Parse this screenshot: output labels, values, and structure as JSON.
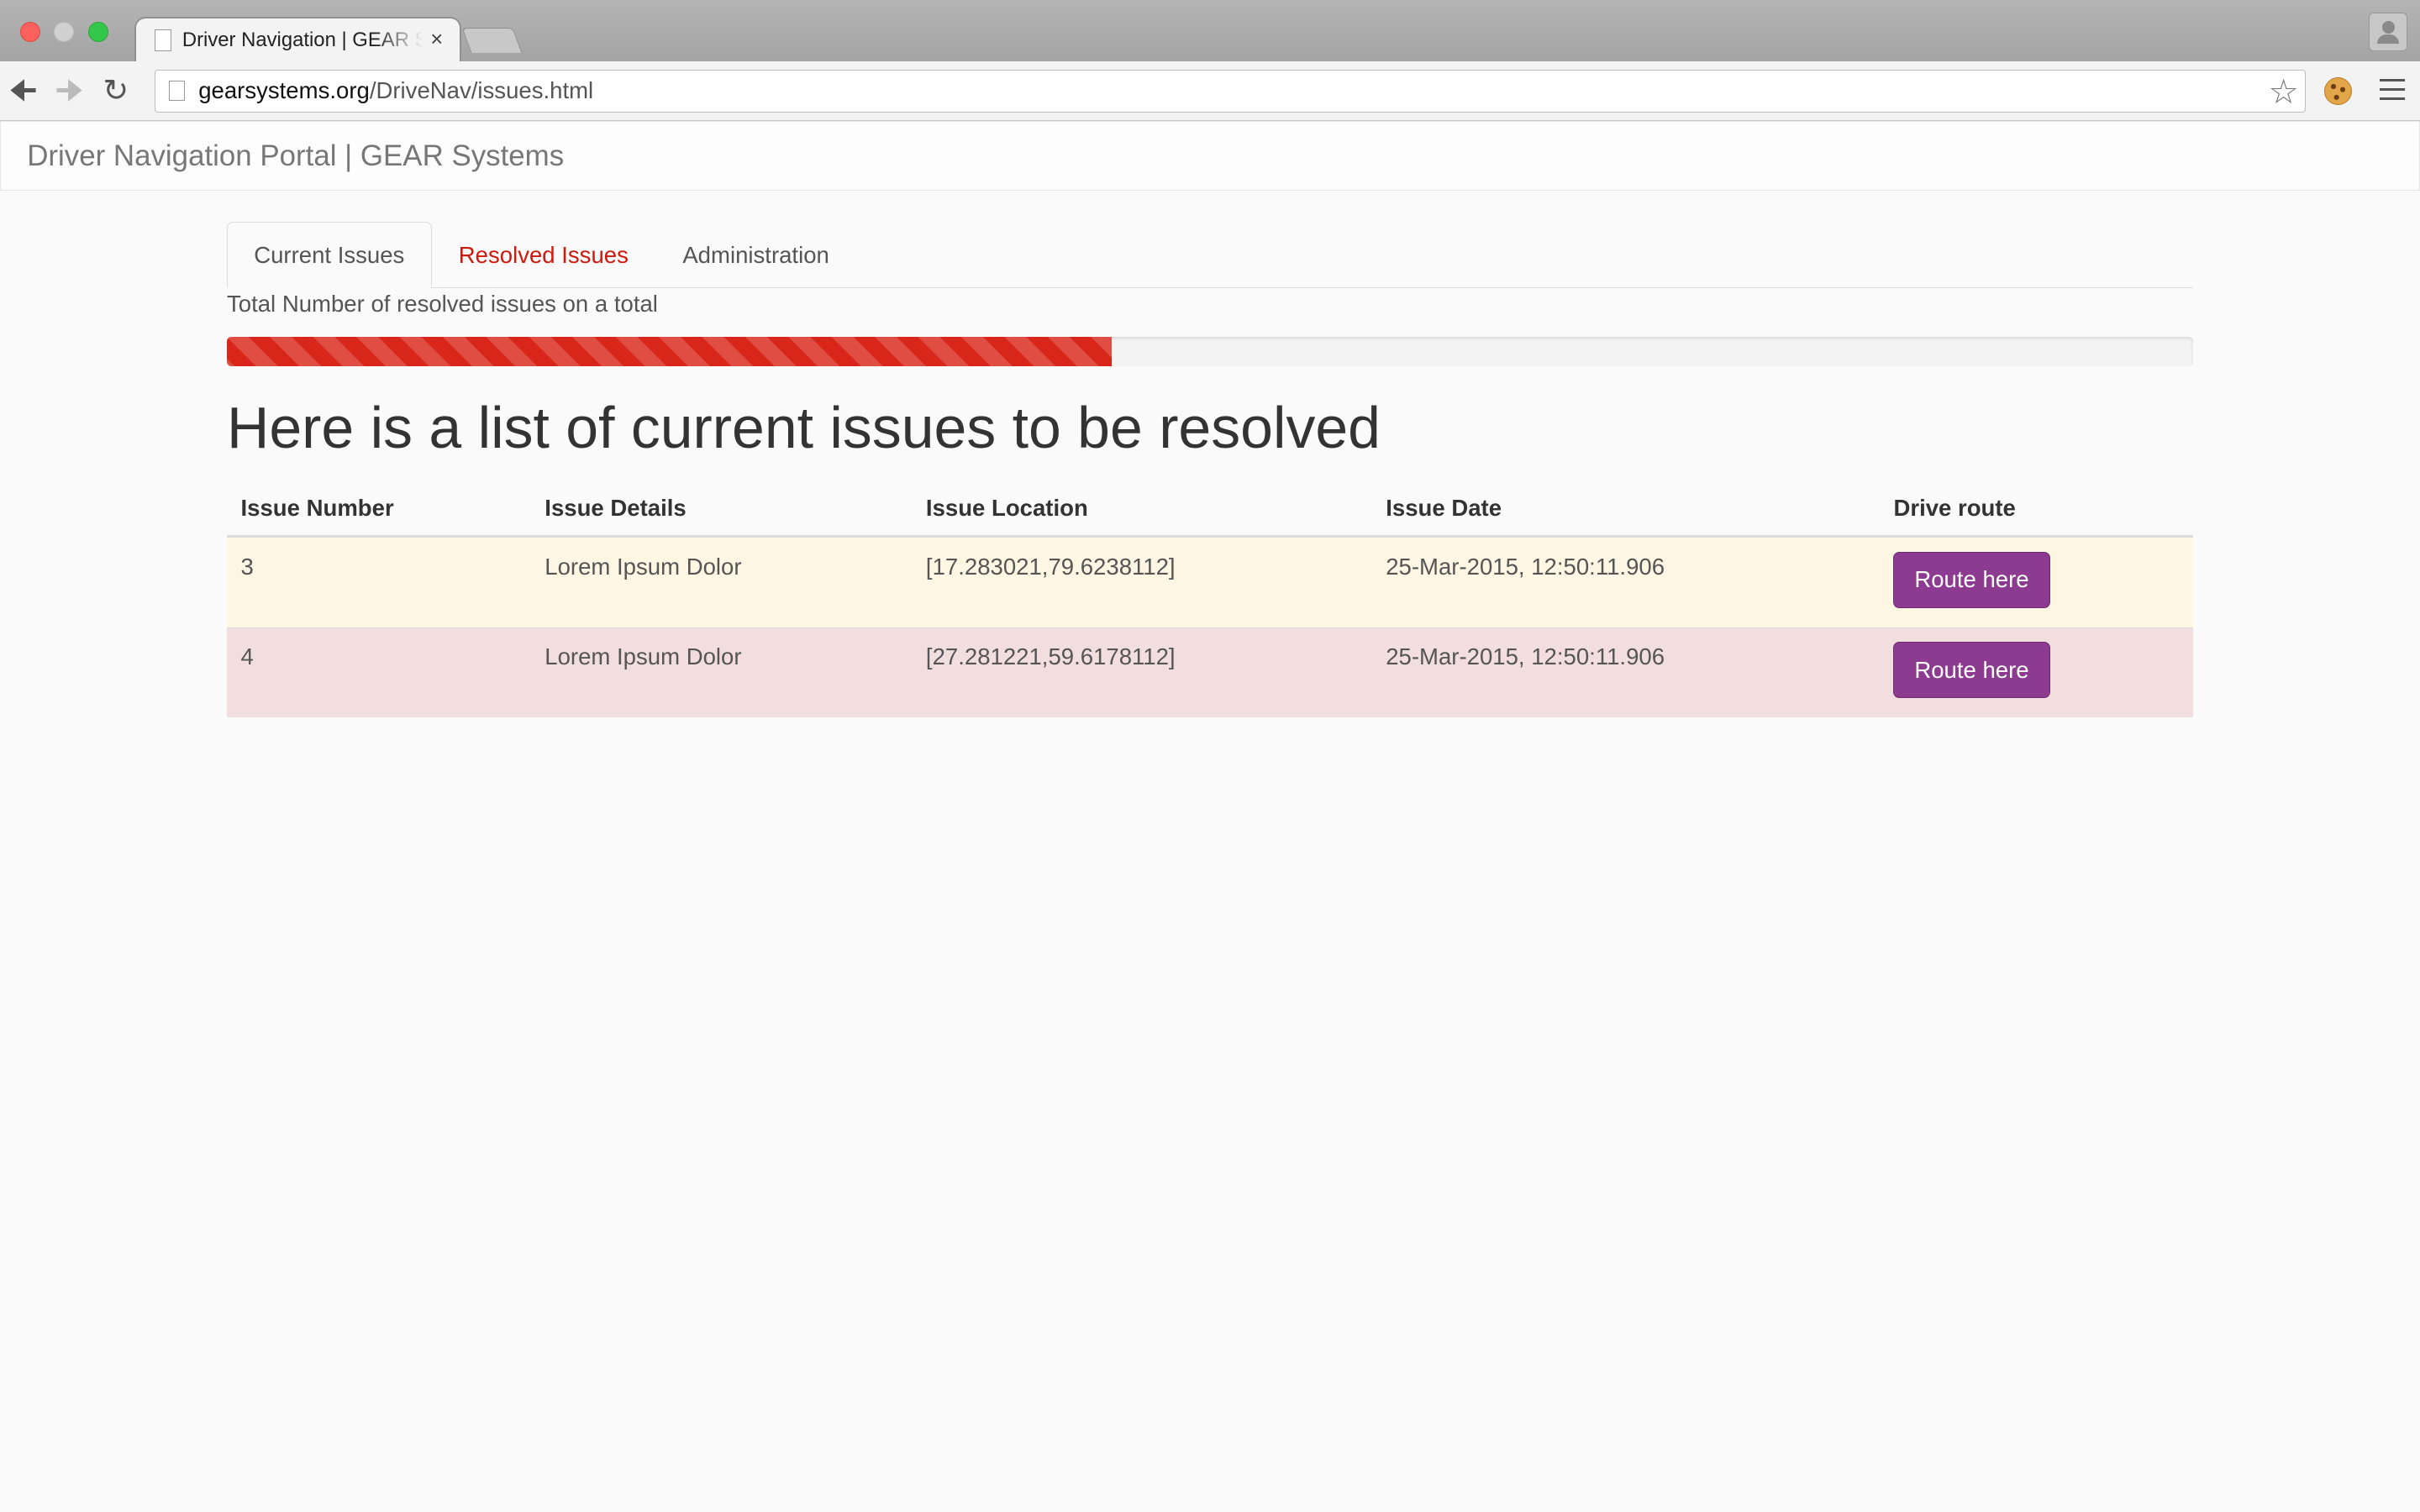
{
  "browser": {
    "tab_title": "Driver Navigation | GEAR Systems",
    "tab_close": "×",
    "url_host": "gearsystems.org",
    "url_path": "/DriveNav/issues.html"
  },
  "navbar": {
    "brand": "Driver Navigation Portal | GEAR Systems"
  },
  "tabs": [
    {
      "label": "Current Issues"
    },
    {
      "label": "Resolved Issues"
    },
    {
      "label": "Administration"
    }
  ],
  "progress": {
    "label": "Total Number of resolved issues on a total",
    "fraction": 0.45,
    "color": "#d9261a"
  },
  "heading": "Here is a list of current issues to be resolved",
  "table": {
    "headers": [
      "Issue Number",
      "Issue Details",
      "Issue Location",
      "Issue Date",
      "Drive route"
    ],
    "rows": [
      {
        "number": "3",
        "details": "Lorem Ipsum Dolor",
        "location": "[17.283021,79.6238112]",
        "date": "25-Mar-2015, 12:50:11.906",
        "action": "Route here"
      },
      {
        "number": "4",
        "details": "Lorem Ipsum Dolor",
        "location": "[27.281221,59.6178112]",
        "date": "25-Mar-2015, 12:50:11.906",
        "action": "Route here"
      }
    ]
  },
  "colors": {
    "accent_button": "#8d3a91",
    "tab_red": "#cc1a0e",
    "row_warning": "#fcf6e3",
    "row_danger": "#f2dede"
  }
}
